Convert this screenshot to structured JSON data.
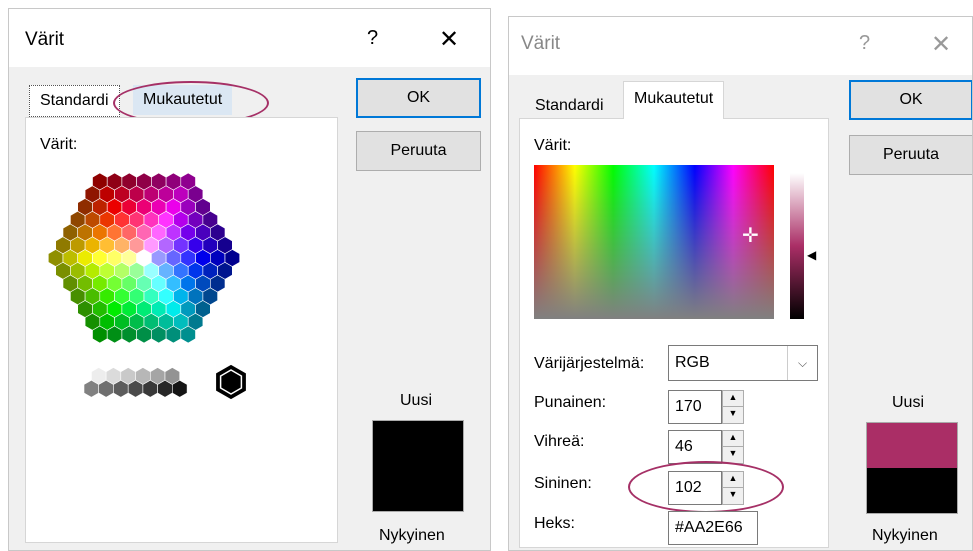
{
  "left_dialog": {
    "title": "Värit",
    "help": "?",
    "close": "✕",
    "tabs": [
      {
        "label": "Standardi"
      },
      {
        "label": "Mukautetut"
      }
    ],
    "colors_label": "Värit:",
    "ok_label": "OK",
    "cancel_label": "Peruuta",
    "new_label": "Uusi",
    "current_label": "Nykyinen",
    "new_color": "#000000",
    "current_color": "#000000"
  },
  "right_dialog": {
    "title": "Värit",
    "help": "?",
    "close": "✕",
    "tabs": [
      {
        "label": "Standardi"
      },
      {
        "label": "Mukautetut"
      }
    ],
    "colors_label": "Värit:",
    "color_model_label": "Värijärjestelmä:",
    "color_model_value": "RGB",
    "red_label": "Punainen:",
    "red_value": "170",
    "green_label": "Vihreä:",
    "green_value": "46",
    "blue_label": "Sininen:",
    "blue_value": "102",
    "hex_label": "Heks:",
    "hex_value": "#AA2E66",
    "ok_label": "OK",
    "cancel_label": "Peruuta",
    "new_label": "Uusi",
    "current_label": "Nykyinen",
    "new_color": "#AA2E66",
    "current_color": "#000000"
  },
  "highlight_color": "#A53066"
}
